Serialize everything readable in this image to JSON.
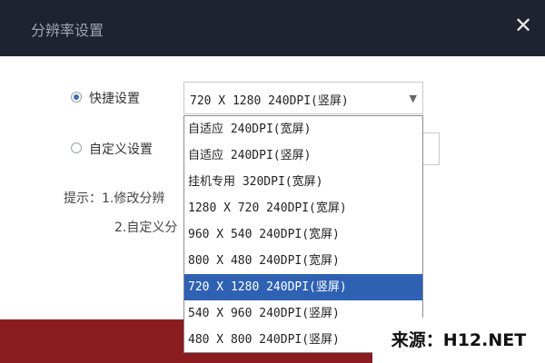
{
  "window": {
    "title": "分辨率设置",
    "close_glyph": "✕"
  },
  "quick": {
    "label": "快捷设置",
    "selected_value": "720 X 1280 240DPI(竖屏)",
    "options": [
      "自适应 240DPI(宽屏)",
      "自适应 240DPI(竖屏)",
      "挂机专用 320DPI(宽屏)",
      "1280 X 720 240DPI(宽屏)",
      "960 X 540 240DPI(宽屏)",
      "800 X 480 240DPI(宽屏)",
      "720 X 1280 240DPI(竖屏)",
      "540 X 960 240DPI(竖屏)",
      "480 X 800 240DPI(竖屏)"
    ],
    "selected_index": 6
  },
  "custom": {
    "label": "自定义设置"
  },
  "hint": {
    "line1": "提示：1.修改分辨",
    "line2": "2.自定义分"
  },
  "watermark": "来源：H12.NET",
  "colors": {
    "title_bar": "#1f2330",
    "selection": "#2f61b3",
    "bottom_strip": "#8a1c1f",
    "radio_checked": "#3c6fb5"
  }
}
